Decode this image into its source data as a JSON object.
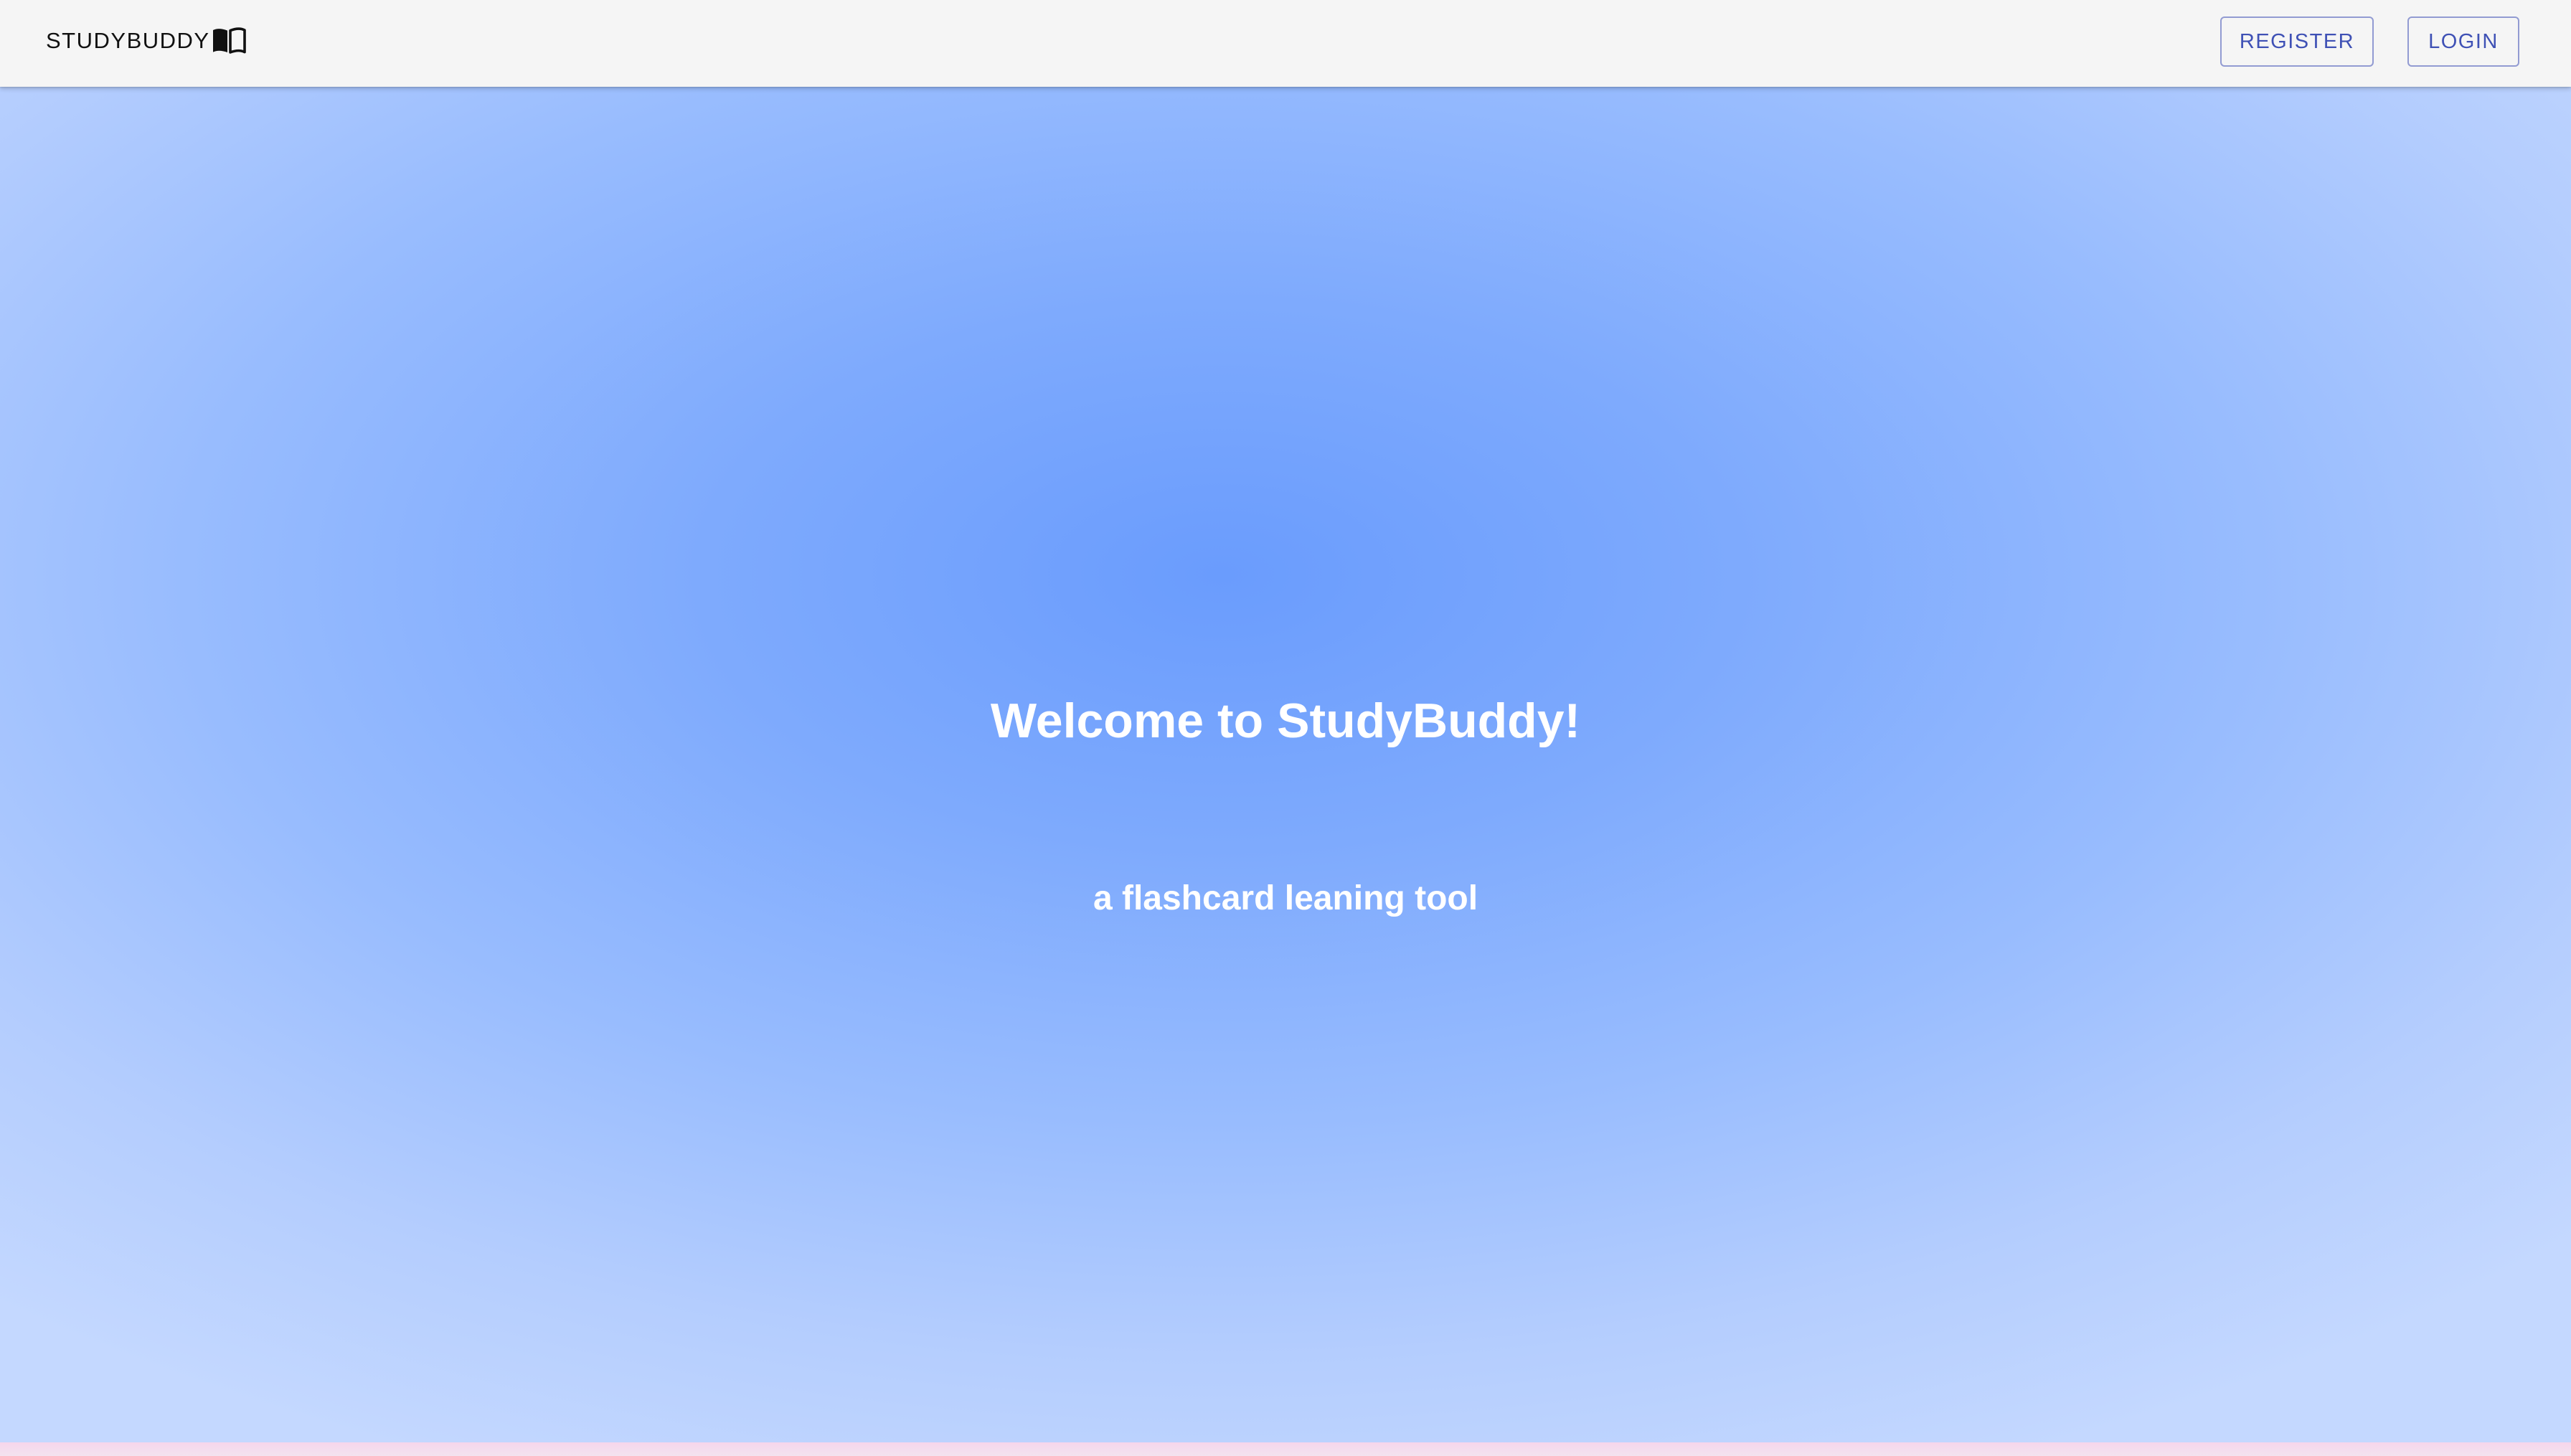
{
  "header": {
    "brand": "STUDYBUDDY",
    "brand_icon": "open-book-icon",
    "register_label": "REGISTER",
    "login_label": "LOGIN"
  },
  "hero": {
    "title": "Welcome to StudyBuddy!",
    "subtitle": "a flashcard leaning tool"
  },
  "colors": {
    "appbar_bg": "#f5f5f5",
    "accent": "#3f51b5",
    "hero_center": "#6a9cfd",
    "hero_edge": "#c4d8ff",
    "hero_text": "#ffffff"
  }
}
